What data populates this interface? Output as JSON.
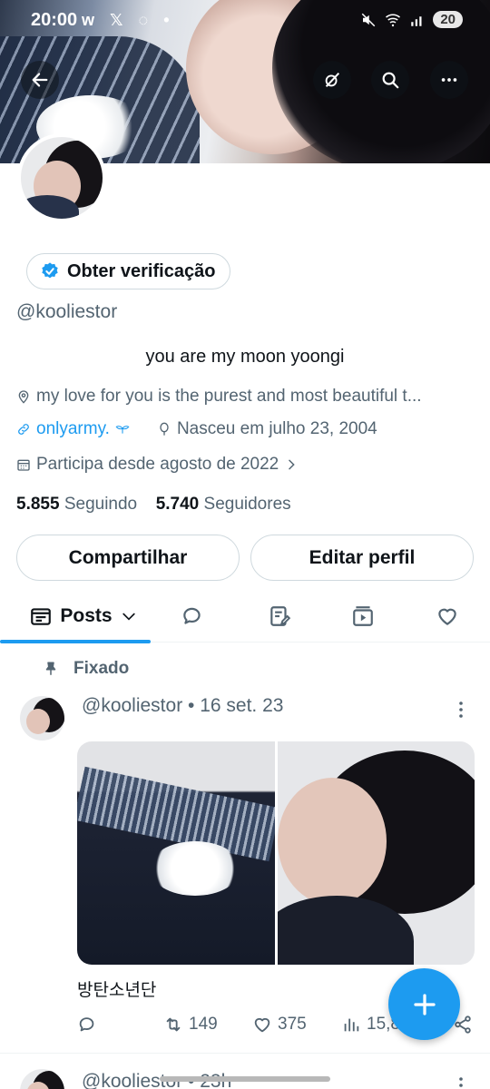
{
  "status_bar": {
    "time": "20:00",
    "app_icons": "w 𝕏 ◌ •",
    "battery": "20"
  },
  "profile": {
    "verify_label": "Obter verificação",
    "handle": "@kooliestor",
    "bio": "you are my moon yoongi",
    "location": "my love for you is the purest and most beautiful t...",
    "link": "onlyarmy.",
    "birth": "Nasceu em julho 23, 2004",
    "joined": "Participa desde agosto de 2022",
    "following_count": "5.855",
    "following_label": "Seguindo",
    "followers_count": "5.740",
    "followers_label": "Seguidores"
  },
  "buttons": {
    "share": "Compartilhar",
    "edit": "Editar perfil"
  },
  "tabs": {
    "posts": "Posts"
  },
  "pinned_post": {
    "pinned_label": "Fixado",
    "header": "@kooliestor • 16 set. 23",
    "caption": "방탄소년단",
    "retweets": "149",
    "likes": "375",
    "views": "15,8"
  },
  "second_post": {
    "header": "@kooliestor • 23h"
  },
  "colors": {
    "accent": "#1d9bf0",
    "text_primary": "#0f1419",
    "text_secondary": "#536471",
    "border": "#cfd9de"
  }
}
